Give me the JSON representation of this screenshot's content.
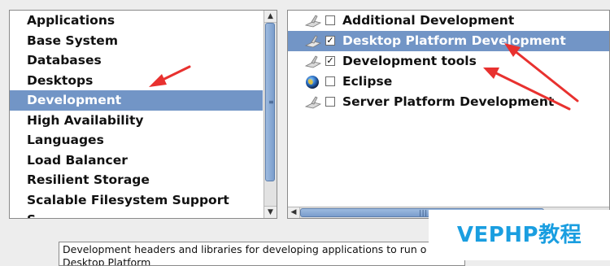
{
  "categories": {
    "items": [
      {
        "label": "Applications"
      },
      {
        "label": "Base System"
      },
      {
        "label": "Databases"
      },
      {
        "label": "Desktops"
      },
      {
        "label": "Development",
        "selected": true
      },
      {
        "label": "High Availability"
      },
      {
        "label": "Languages"
      },
      {
        "label": "Load Balancer"
      },
      {
        "label": "Resilient Storage"
      },
      {
        "label": "Scalable Filesystem Support"
      },
      {
        "label": "S..."
      }
    ],
    "selected_index": 4
  },
  "groups": {
    "items": [
      {
        "label": "Additional Development",
        "icon": "package-icon",
        "checked": false
      },
      {
        "label": "Desktop Platform Development",
        "icon": "package-icon",
        "checked": true,
        "selected": true
      },
      {
        "label": "Development tools",
        "icon": "package-icon",
        "checked": true
      },
      {
        "label": "Eclipse",
        "icon": "eclipse-globe-icon",
        "checked": false
      },
      {
        "label": "Server Platform Development",
        "icon": "package-icon",
        "checked": false
      }
    ]
  },
  "description": {
    "text": "Development headers and libraries for developing applications to run o",
    "text_line2": "Desktop Platform"
  },
  "watermark": {
    "text": "VEPHP教程"
  },
  "colors": {
    "selection": "#7295c6",
    "annotation_arrow": "#e8312f",
    "watermark": "#1a9ee0"
  },
  "glyphs": {
    "scroll_up": "▲",
    "scroll_down": "▼",
    "scroll_left": "◀",
    "check": "✓"
  }
}
